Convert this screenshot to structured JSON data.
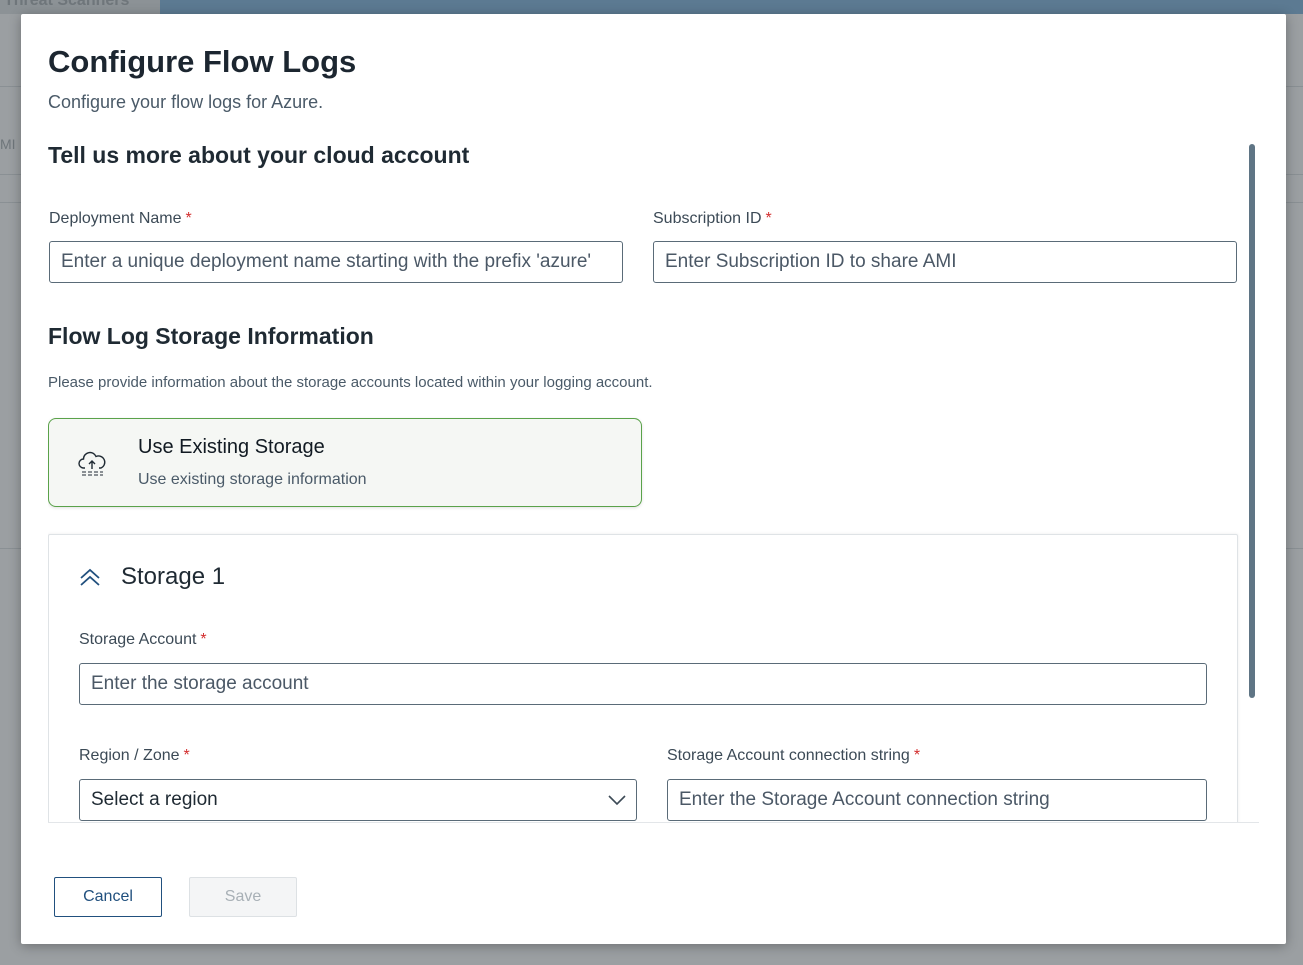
{
  "background": {
    "page_title": "Threat Scanners",
    "partial_text": "MI"
  },
  "modal": {
    "title": "Configure Flow Logs",
    "subtitle": "Configure your flow logs for Azure."
  },
  "cloud_account": {
    "section_title": "Tell us more about your cloud account",
    "deployment_name": {
      "label": "Deployment Name",
      "required_mark": "*",
      "value": "",
      "placeholder": "Enter a unique deployment name starting with the prefix 'azure'"
    },
    "subscription_id": {
      "label": "Subscription ID",
      "required_mark": "*",
      "value": "",
      "placeholder": "Enter Subscription ID to share AMI"
    }
  },
  "storage_info": {
    "section_title": "Flow Log Storage Information",
    "help_text": "Please provide information about the storage accounts located within your logging account.",
    "option_card": {
      "icon": "cloud-upload-icon",
      "title": "Use Existing Storage",
      "description": "Use existing storage information",
      "selected": true
    }
  },
  "storage_panel": {
    "title": "Storage 1",
    "expanded": true,
    "storage_account": {
      "label": "Storage Account",
      "required_mark": "*",
      "value": "",
      "placeholder": "Enter the storage account"
    },
    "region": {
      "label": "Region / Zone",
      "required_mark": "*",
      "selected": "Select a region"
    },
    "connection_string": {
      "label": "Storage Account connection string",
      "required_mark": "*",
      "value": "",
      "placeholder": "Enter the Storage Account connection string"
    }
  },
  "footer": {
    "cancel_label": "Cancel",
    "save_label": "Save",
    "save_enabled": false
  },
  "colors": {
    "primary": "#21507e",
    "selected_card_border": "#5aa24a",
    "required": "#d22d2d",
    "scrollbar": "#5f7585"
  }
}
